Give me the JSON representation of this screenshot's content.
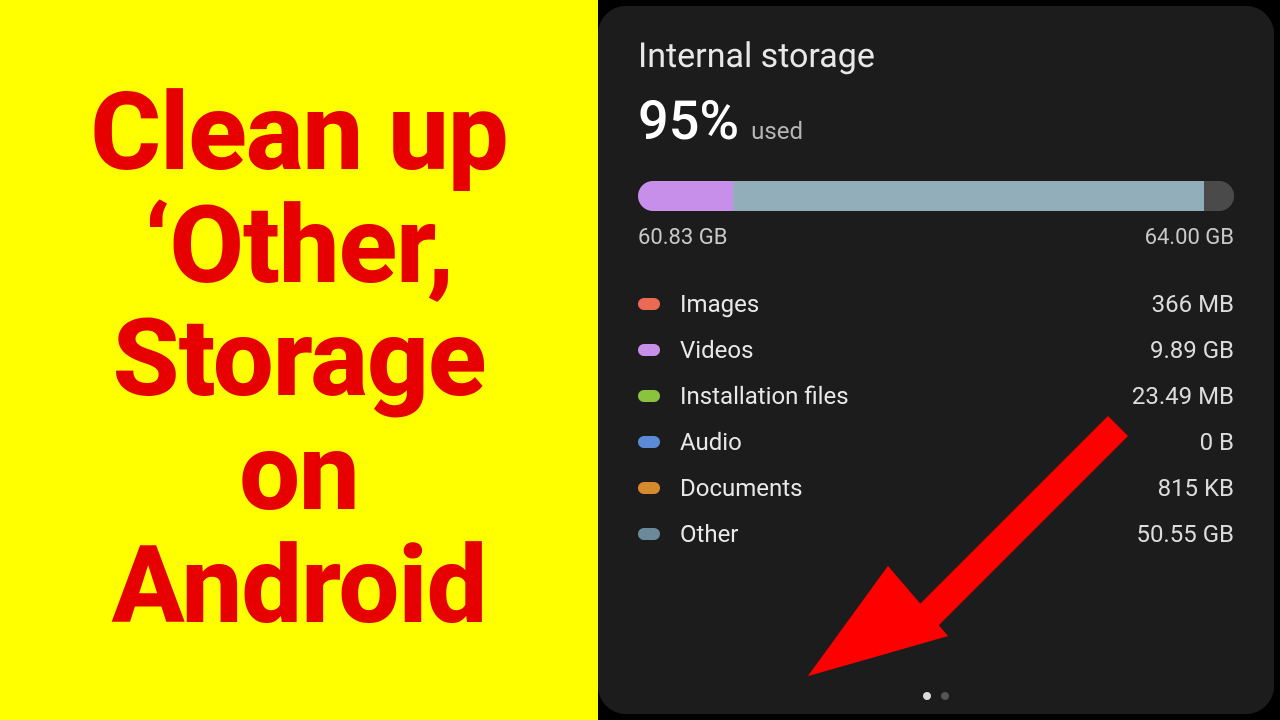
{
  "banner": {
    "line1": "Clean up",
    "line2": "‘Other,",
    "line3": "Storage",
    "line4": "on",
    "line5": "Android"
  },
  "storage": {
    "title": "Internal storage",
    "percent": "95%",
    "used_label": "used",
    "used_amount": "60.83 GB",
    "total_amount": "64.00 GB",
    "segments": {
      "videos_pct": 16,
      "main_pct": 79,
      "free_pct": 5
    },
    "categories": [
      {
        "name": "Images",
        "size": "366 MB",
        "color": "#ea6a52"
      },
      {
        "name": "Videos",
        "size": "9.89 GB",
        "color": "#c88fea"
      },
      {
        "name": "Installation files",
        "size": "23.49 MB",
        "color": "#8ac43f"
      },
      {
        "name": "Audio",
        "size": "0 B",
        "color": "#5b8bd6"
      },
      {
        "name": "Documents",
        "size": "815 KB",
        "color": "#d68a2e"
      },
      {
        "name": "Other",
        "size": "50.55 GB",
        "color": "#6b8a99"
      }
    ],
    "pager": {
      "count": 2,
      "active": 0
    }
  },
  "overlay": {
    "arrow_color": "#ff0000"
  }
}
